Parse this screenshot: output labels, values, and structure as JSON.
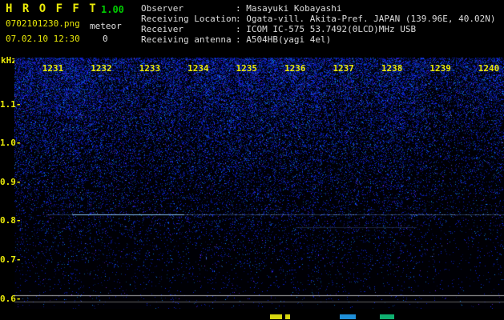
{
  "header": {
    "app_name": "H R O F F T",
    "version": "1.00",
    "filename": "0702101230.png",
    "mode_label": "meteor",
    "datetime": "07.02.10 12:30",
    "count": "0",
    "info_rows": [
      {
        "label": "Observer",
        "value": ": Masayuki Kobayashi"
      },
      {
        "label": "Receiving Location",
        "value": ": Ogata-vill. Akita-Pref. JAPAN (139.96E, 40.02N)"
      },
      {
        "label": "Receiver",
        "value": ": ICOM IC-575 53.7492(0LCD)MHz USB"
      },
      {
        "label": "Receiving antenna",
        "value": ": A504HB(yagi 4el)"
      }
    ]
  },
  "chart_data": {
    "type": "heatmap",
    "subtype": "radio-meteor-spectrogram",
    "ylabel": "kHz",
    "y_tick_labels": [
      "1.1",
      "1.0",
      "0.9",
      "0.8",
      "0.7",
      "0.6"
    ],
    "x_tick_labels": [
      "1231",
      "1232",
      "1233",
      "1234",
      "1235",
      "1236",
      "1237",
      "1238",
      "1239",
      "1240"
    ],
    "ylim": [
      0.58,
      1.18
    ],
    "grid": false,
    "legend": "none",
    "background_noise": "blue speckle noise, densest at high frequencies and upper corners, fading to black below 0.65 kHz",
    "features": [
      {
        "kind": "carrier-trace",
        "freq_khz": 0.82,
        "from": "1231",
        "to": "1240",
        "note": "thin horizontal blue trace across full width, brightest between 1232 and 1234"
      },
      {
        "kind": "faint-trace",
        "freq_khz": 0.79,
        "from": "1236",
        "to": "1238",
        "note": "very faint short horizontal trace"
      },
      {
        "kind": "reference-line",
        "freq_khz": 0.608,
        "from": "1231",
        "to": "1240",
        "note": "thin light gray line across full width"
      },
      {
        "kind": "reference-line",
        "freq_khz": 0.592,
        "from": "1231",
        "to": "1240",
        "note": "thin dimmer gray line across full width"
      }
    ]
  },
  "colors": {
    "axis_yellow": "#e9e909",
    "version_green": "#00cc00",
    "info_white": "#dcdcdc",
    "noise_blue": "#2038c8",
    "carrier_line": "#8cc8ff",
    "reference_line": "#c8c8c8",
    "background": "#000000"
  },
  "bottom_fragments": [
    {
      "x": 337,
      "w": 15,
      "color": "#d8d810"
    },
    {
      "x": 356,
      "w": 6,
      "color": "#d8d810"
    },
    {
      "x": 424,
      "w": 20,
      "color": "#1f8fd8"
    },
    {
      "x": 474,
      "w": 18,
      "color": "#10b070"
    }
  ]
}
